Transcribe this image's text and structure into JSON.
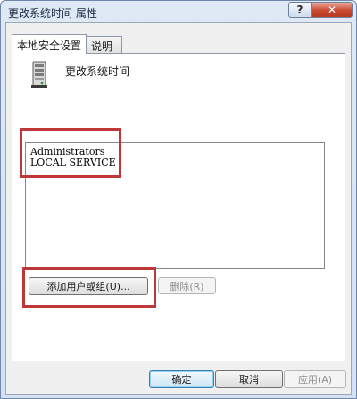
{
  "window": {
    "title": "更改系统时间 属性",
    "help_label": "?",
    "close_label": "✕"
  },
  "tabs": [
    {
      "label": "本地安全设置",
      "active": true
    },
    {
      "label": "说明",
      "active": false
    }
  ],
  "policy": {
    "name": "更改系统时间",
    "icon": "server-icon"
  },
  "accounts": [
    "Administrators",
    "LOCAL SERVICE"
  ],
  "buttons": {
    "add": "添加用户或组(U)...",
    "remove": "删除(R)",
    "ok": "确定",
    "cancel": "取消",
    "apply": "应用(A)"
  },
  "colors": {
    "highlight": "#c0373a",
    "close_button": "#c8472f",
    "default_button_border": "#3c7fb1"
  }
}
